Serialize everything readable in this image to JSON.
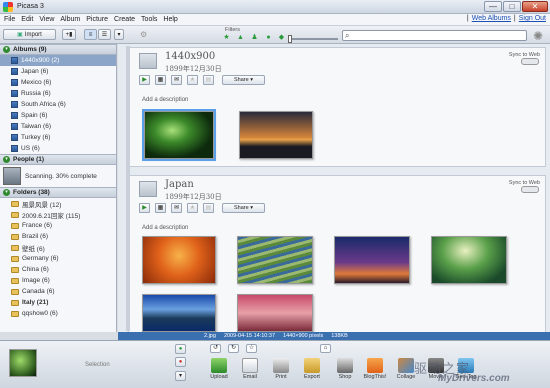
{
  "window": {
    "title": "Picasa 3",
    "minimize": "—",
    "maximize": "□",
    "close": "✕"
  },
  "menu": {
    "items": [
      "File",
      "Edit",
      "View",
      "Album",
      "Picture",
      "Create",
      "Tools",
      "Help"
    ],
    "links": [
      "Web Albums",
      "Sign Out"
    ],
    "separator": "|"
  },
  "toolbar": {
    "import_label": "Import",
    "filters_label": "Filters",
    "search_value": "",
    "search_placeholder": ""
  },
  "sidebar": {
    "albums_header": "Albums (9)",
    "albums": [
      {
        "label": "1440x900 (2)",
        "selected": true
      },
      {
        "label": "Japan (6)"
      },
      {
        "label": "Mexico (6)"
      },
      {
        "label": "Russia (6)"
      },
      {
        "label": "South Africa (6)"
      },
      {
        "label": "Spain (6)"
      },
      {
        "label": "Taiwan (6)"
      },
      {
        "label": "Turkey (6)"
      },
      {
        "label": "US (6)"
      }
    ],
    "people_header": "People (1)",
    "people_status": "Scanning. 30% complete",
    "people_progress_percent": 30,
    "folders_header": "Folders (38)",
    "folders": [
      {
        "label": "風景风景 (12)"
      },
      {
        "label": "2009.6.21回家 (115)"
      },
      {
        "label": "France (6)"
      },
      {
        "label": "Brazil (6)"
      },
      {
        "label": "壁纸 (6)"
      },
      {
        "label": "Germany (6)"
      },
      {
        "label": "China (6)"
      },
      {
        "label": "Image (6)"
      },
      {
        "label": "Canada (6)"
      },
      {
        "label": "Italy (21)",
        "bold": true
      },
      {
        "label": "qqshow0 (6)"
      }
    ]
  },
  "panels": [
    {
      "title": "1440x900",
      "date": "1899年12月30日",
      "sync_label": "Sync to Web",
      "share_label": "Share",
      "description_placeholder": "Add a description"
    },
    {
      "title": "Japan",
      "date": "1899年12月30日",
      "sync_label": "Sync to Web",
      "share_label": "Share",
      "description_placeholder": "Add a description"
    }
  ],
  "statusbar": {
    "file": "2.jpg",
    "timestamp": "2009-04-15 14:10:37",
    "dimensions": "1440×900 pixels",
    "size": "138KB"
  },
  "tray": {
    "selection_label": "Selection",
    "actions": [
      "Upload",
      "Email",
      "Print",
      "Export",
      "Shop",
      "BlogThis!",
      "Collage",
      "Movie",
      "Geo-Tag"
    ]
  },
  "watermark": {
    "line1": "驱动之家",
    "line2": "MyDrivers.com"
  }
}
